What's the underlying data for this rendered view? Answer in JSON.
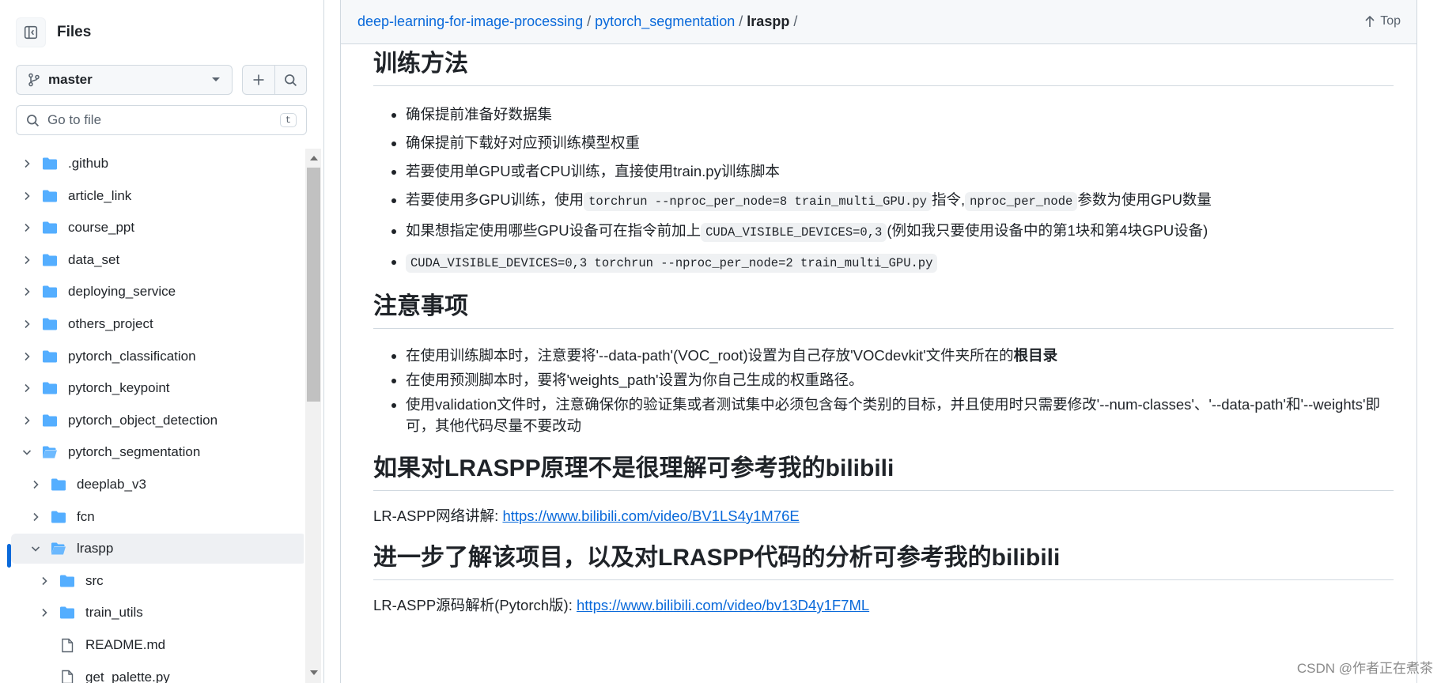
{
  "sidebar": {
    "title": "Files",
    "branch": "master",
    "search_placeholder": "Go to file",
    "search_shortcut": "t",
    "tree": [
      {
        "name": ".github",
        "type": "folder",
        "depth": 0,
        "expanded": false
      },
      {
        "name": "article_link",
        "type": "folder",
        "depth": 0,
        "expanded": false
      },
      {
        "name": "course_ppt",
        "type": "folder",
        "depth": 0,
        "expanded": false
      },
      {
        "name": "data_set",
        "type": "folder",
        "depth": 0,
        "expanded": false
      },
      {
        "name": "deploying_service",
        "type": "folder",
        "depth": 0,
        "expanded": false
      },
      {
        "name": "others_project",
        "type": "folder",
        "depth": 0,
        "expanded": false
      },
      {
        "name": "pytorch_classification",
        "type": "folder",
        "depth": 0,
        "expanded": false
      },
      {
        "name": "pytorch_keypoint",
        "type": "folder",
        "depth": 0,
        "expanded": false
      },
      {
        "name": "pytorch_object_detection",
        "type": "folder",
        "depth": 0,
        "expanded": false
      },
      {
        "name": "pytorch_segmentation",
        "type": "folder",
        "depth": 0,
        "expanded": true
      },
      {
        "name": "deeplab_v3",
        "type": "folder",
        "depth": 1,
        "expanded": false
      },
      {
        "name": "fcn",
        "type": "folder",
        "depth": 1,
        "expanded": false
      },
      {
        "name": "lraspp",
        "type": "folder",
        "depth": 1,
        "expanded": true,
        "selected": true
      },
      {
        "name": "src",
        "type": "folder",
        "depth": 2,
        "expanded": false
      },
      {
        "name": "train_utils",
        "type": "folder",
        "depth": 2,
        "expanded": false
      },
      {
        "name": "README.md",
        "type": "file",
        "depth": 2
      },
      {
        "name": "get_palette.py",
        "type": "file",
        "depth": 2
      }
    ]
  },
  "breadcrumb": {
    "repo": "deep-learning-for-image-processing",
    "folder": "pytorch_segmentation",
    "current": "lraspp",
    "sep": "/",
    "trailing_sep": "/"
  },
  "top_link": "Top",
  "article": {
    "s1_title": "训练方法",
    "s1_items": {
      "i1": "确保提前准备好数据集",
      "i2": "确保提前下载好对应预训练模型权重",
      "i3": "若要使用单GPU或者CPU训练，直接使用train.py训练脚本",
      "i4a": "若要使用多GPU训练，使用",
      "i4code1": "torchrun --nproc_per_node=8 train_multi_GPU.py",
      "i4b": "指令,",
      "i4code2": "nproc_per_node",
      "i4c": "参数为使用GPU数量",
      "i5a": "如果想指定使用哪些GPU设备可在指令前加上",
      "i5code": "CUDA_VISIBLE_DEVICES=0,3",
      "i5b": "(例如我只要使用设备中的第1块和第4块GPU设备)",
      "i6code": "CUDA_VISIBLE_DEVICES=0,3 torchrun --nproc_per_node=2 train_multi_GPU.py"
    },
    "s2_title": "注意事项",
    "s2_items": {
      "i1a": "在使用训练脚本时，注意要将'--data-path'(VOC_root)设置为自己存放'VOCdevkit'文件夹所在的",
      "i1b": "根目录",
      "i2": "在使用预测脚本时，要将'weights_path'设置为你自己生成的权重路径。",
      "i3": "使用validation文件时，注意确保你的验证集或者测试集中必须包含每个类别的目标，并且使用时只需要修改'--num-classes'、'--data-path'和'--weights'即可，其他代码尽量不要改动"
    },
    "s3_title": "如果对LRASPP原理不是很理解可参考我的bilibili",
    "s3_text": "LR-ASPP网络讲解: ",
    "s3_link": "https://www.bilibili.com/video/BV1LS4y1M76E",
    "s4_title": "进一步了解该项目，以及对LRASPP代码的分析可参考我的bilibili",
    "s4_text": "LR-ASPP源码解析(Pytorch版): ",
    "s4_link": "https://www.bilibili.com/video/bv13D4y1F7ML"
  },
  "watermark": "CSDN @作者正在煮茶",
  "colors": {
    "accent": "#0969da",
    "folder": "#54aeff",
    "text": "#1f2328",
    "muted": "#59636e"
  }
}
